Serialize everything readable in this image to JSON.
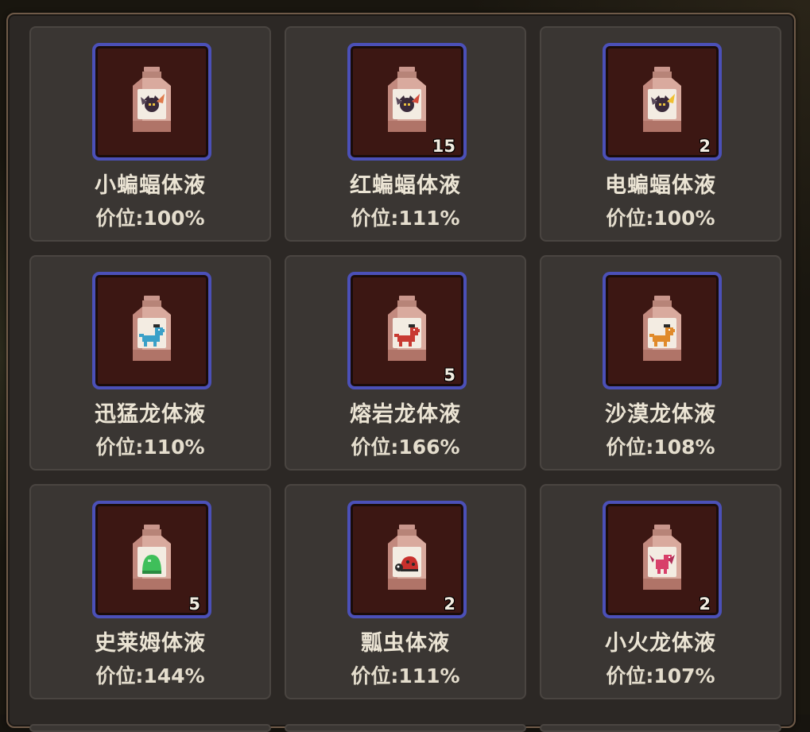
{
  "colors": {
    "panel_bg": "#2c2825",
    "card_bg": "#3a3633",
    "slot_bg": "#3c1713",
    "slot_border": "#4b50b8",
    "text": "#ebe4d4"
  },
  "items": [
    {
      "name": "小蝙蝠体液",
      "price": "价位:100%",
      "count": "",
      "icon": "small-bat-essence-icon",
      "creature": "bat",
      "accent": "#e07a4a"
    },
    {
      "name": "红蝙蝠体液",
      "price": "价位:111%",
      "count": "15",
      "icon": "red-bat-essence-icon",
      "creature": "bat",
      "accent": "#d24a3a"
    },
    {
      "name": "电蝙蝠体液",
      "price": "价位:100%",
      "count": "2",
      "icon": "electric-bat-essence-icon",
      "creature": "bat",
      "accent": "#f0c030"
    },
    {
      "name": "迅猛龙体液",
      "price": "价位:110%",
      "count": "",
      "icon": "raptor-essence-icon",
      "creature": "dino",
      "accent": "#3aa0c8"
    },
    {
      "name": "熔岩龙体液",
      "price": "价位:166%",
      "count": "5",
      "icon": "lava-dragon-essence-icon",
      "creature": "dino",
      "accent": "#c83a32"
    },
    {
      "name": "沙漠龙体液",
      "price": "价位:108%",
      "count": "",
      "icon": "desert-dragon-essence-icon",
      "creature": "dino",
      "accent": "#e08a2a"
    },
    {
      "name": "史莱姆体液",
      "price": "价位:144%",
      "count": "5",
      "icon": "slime-essence-icon",
      "creature": "slime",
      "accent": "#3fbf5a"
    },
    {
      "name": "瓢虫体液",
      "price": "价位:111%",
      "count": "2",
      "icon": "ladybug-essence-icon",
      "creature": "ladybug",
      "accent": "#c8302c"
    },
    {
      "name": "小火龙体液",
      "price": "价位:107%",
      "count": "2",
      "icon": "small-fire-dragon-essence-icon",
      "creature": "drake",
      "accent": "#d8406a"
    }
  ]
}
